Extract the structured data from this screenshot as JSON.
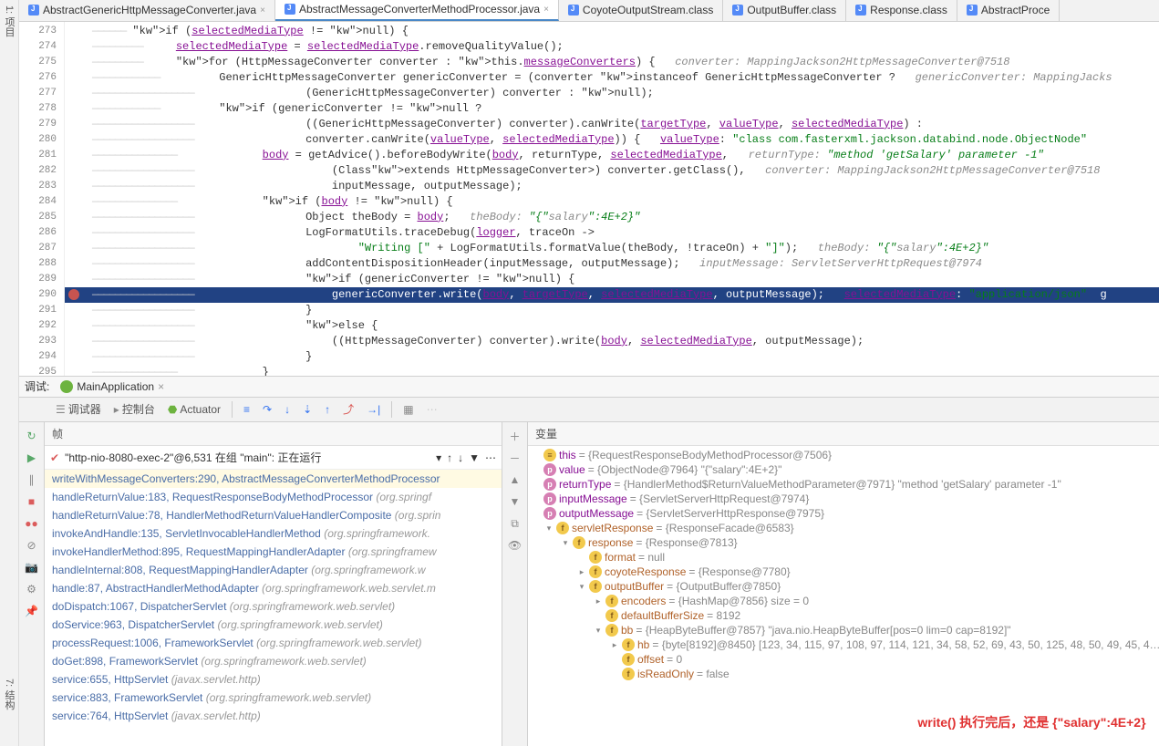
{
  "side_label_top": "1: 项目",
  "side_label_bottom": "7: 结构",
  "tabs": [
    {
      "label": "AbstractGenericHttpMessageConverter.java",
      "active": false,
      "close": "×"
    },
    {
      "label": "AbstractMessageConverterMethodProcessor.java",
      "active": true,
      "close": "×"
    },
    {
      "label": "CoyoteOutputStream.class",
      "active": false,
      "close": ""
    },
    {
      "label": "OutputBuffer.class",
      "active": false,
      "close": ""
    },
    {
      "label": "Response.class",
      "active": false,
      "close": ""
    },
    {
      "label": "AbstractProce",
      "active": false,
      "close": ""
    }
  ],
  "lines": {
    "start": 273,
    "highlight": 290,
    "breakpoint": 290
  },
  "code": [
    "if (selectedMediaType != null) {",
    "    selectedMediaType = selectedMediaType.removeQualityValue();",
    "    for (HttpMessageConverter<?> converter : this.messageConverters) {   converter: MappingJackson2HttpMessageConverter@7518",
    "        GenericHttpMessageConverter genericConverter = (converter instanceof GenericHttpMessageConverter ?   genericConverter: MappingJacks",
    "                (GenericHttpMessageConverter<?>) converter : null);",
    "        if (genericConverter != null ?",
    "                ((GenericHttpMessageConverter) converter).canWrite(targetType, valueType, selectedMediaType) :",
    "                converter.canWrite(valueType, selectedMediaType)) {   valueType: \"class com.fasterxml.jackson.databind.node.ObjectNode\"",
    "            body = getAdvice().beforeBodyWrite(body, returnType, selectedMediaType,   returnType: \"method 'getSalary' parameter -1\"",
    "                    (Class<? extends HttpMessageConverter<?>>) converter.getClass(),   converter: MappingJackson2HttpMessageConverter@7518",
    "                    inputMessage, outputMessage);",
    "            if (body != null) {",
    "                Object theBody = body;   theBody: \"{\"salary\":4E+2}\"",
    "                LogFormatUtils.traceDebug(logger, traceOn ->",
    "                        \"Writing [\" + LogFormatUtils.formatValue(theBody, !traceOn) + \"]\");   theBody: \"{\"salary\":4E+2}\"",
    "                addContentDispositionHeader(inputMessage, outputMessage);   inputMessage: ServletServerHttpRequest@7974",
    "                if (genericConverter != null) {",
    "                    genericConverter.write(body, targetType, selectedMediaType, outputMessage);   selectedMediaType: \"application/json\"  g",
    "                }",
    "                else {",
    "                    ((HttpMessageConverter) converter).write(body, selectedMediaType, outputMessage);",
    "                }",
    "            }"
  ],
  "debug_label": "调试:",
  "debug_app": "MainApplication",
  "debug_close": "×",
  "toolbar": {
    "debugger": "调试器",
    "console": "控制台",
    "actuator": "Actuator"
  },
  "frames_header": "帧",
  "vars_header": "变量",
  "thread": {
    "name": "\"http-nio-8080-exec-2\"@6,531 在组 \"main\": 正在运行"
  },
  "frames": [
    {
      "m": "writeWithMessageConverters:290, AbstractMessageConverterMethodProcessor",
      "p": "",
      "sel": true
    },
    {
      "m": "handleReturnValue:183, RequestResponseBodyMethodProcessor",
      "p": "(org.springf"
    },
    {
      "m": "handleReturnValue:78, HandlerMethodReturnValueHandlerComposite",
      "p": "(org.sprin"
    },
    {
      "m": "invokeAndHandle:135, ServletInvocableHandlerMethod",
      "p": "(org.springframework."
    },
    {
      "m": "invokeHandlerMethod:895, RequestMappingHandlerAdapter",
      "p": "(org.springframew"
    },
    {
      "m": "handleInternal:808, RequestMappingHandlerAdapter",
      "p": "(org.springframework.w"
    },
    {
      "m": "handle:87, AbstractHandlerMethodAdapter",
      "p": "(org.springframework.web.servlet.m"
    },
    {
      "m": "doDispatch:1067, DispatcherServlet",
      "p": "(org.springframework.web.servlet)"
    },
    {
      "m": "doService:963, DispatcherServlet",
      "p": "(org.springframework.web.servlet)"
    },
    {
      "m": "processRequest:1006, FrameworkServlet",
      "p": "(org.springframework.web.servlet)"
    },
    {
      "m": "doGet:898, FrameworkServlet",
      "p": "(org.springframework.web.servlet)"
    },
    {
      "m": "service:655, HttpServlet",
      "p": "(javax.servlet.http)"
    },
    {
      "m": "service:883, FrameworkServlet",
      "p": "(org.springframework.web.servlet)"
    },
    {
      "m": "service:764, HttpServlet",
      "p": "(javax.servlet.http)"
    }
  ],
  "vars": [
    {
      "d": 0,
      "t": "",
      "ic": "y",
      "icl": "≡",
      "n": "this",
      "v": "= {RequestResponseBodyMethodProcessor@7506}",
      "brown": false
    },
    {
      "d": 0,
      "t": "",
      "ic": "p",
      "icl": "p",
      "n": "value",
      "v": "= {ObjectNode@7964} \"{\"salary\":4E+2}\"",
      "brown": false
    },
    {
      "d": 0,
      "t": "",
      "ic": "p",
      "icl": "p",
      "n": "returnType",
      "v": "= {HandlerMethod$ReturnValueMethodParameter@7971} \"method 'getSalary' parameter -1\"",
      "brown": false
    },
    {
      "d": 0,
      "t": "",
      "ic": "p",
      "icl": "p",
      "n": "inputMessage",
      "v": "= {ServletServerHttpRequest@7974}",
      "brown": false
    },
    {
      "d": 0,
      "t": "",
      "ic": "p",
      "icl": "p",
      "n": "outputMessage",
      "v": "= {ServletServerHttpResponse@7975}",
      "brown": false
    },
    {
      "d": 1,
      "t": "▾",
      "ic": "y",
      "icl": "f",
      "n": "servletResponse",
      "v": "= {ResponseFacade@6583}",
      "brown": true
    },
    {
      "d": 2,
      "t": "▾",
      "ic": "y",
      "icl": "f",
      "n": "response",
      "v": "= {Response@7813}",
      "brown": true
    },
    {
      "d": 3,
      "t": "",
      "ic": "y",
      "icl": "f",
      "n": "format",
      "v": "= null",
      "brown": true
    },
    {
      "d": 3,
      "t": "▸",
      "ic": "y",
      "icl": "f",
      "n": "coyoteResponse",
      "v": "= {Response@7780}",
      "brown": true
    },
    {
      "d": 3,
      "t": "▾",
      "ic": "y",
      "icl": "f",
      "n": "outputBuffer",
      "v": "= {OutputBuffer@7850}",
      "brown": true
    },
    {
      "d": 4,
      "t": "▸",
      "ic": "y",
      "icl": "f",
      "n": "encoders",
      "v": "= {HashMap@7856}  size = 0",
      "brown": true
    },
    {
      "d": 4,
      "t": "",
      "ic": "y",
      "icl": "f",
      "n": "defaultBufferSize",
      "v": "= 8192",
      "brown": true
    },
    {
      "d": 4,
      "t": "▾",
      "ic": "y",
      "icl": "f",
      "n": "bb",
      "v": "= {HeapByteBuffer@7857} \"java.nio.HeapByteBuffer[pos=0 lim=0 cap=8192]\"",
      "brown": true
    },
    {
      "d": 5,
      "t": "▸",
      "ic": "y",
      "icl": "f",
      "n": "hb",
      "v": "= {byte[8192]@8450} [123, 34, 115, 97, 108, 97, 114, 121, 34, 58, 52, 69, 43, 50, 125, 48, 50, 49, 45, 4…",
      "brown": true
    },
    {
      "d": 5,
      "t": "",
      "ic": "y",
      "icl": "f",
      "n": "offset",
      "v": "= 0",
      "brown": true
    },
    {
      "d": 5,
      "t": "",
      "ic": "y",
      "icl": "f",
      "n": "isReadOnly",
      "v": "= false",
      "brown": true
    }
  ],
  "annotation": "write() 执行完后，还是 {\"salary\":4E+2}"
}
